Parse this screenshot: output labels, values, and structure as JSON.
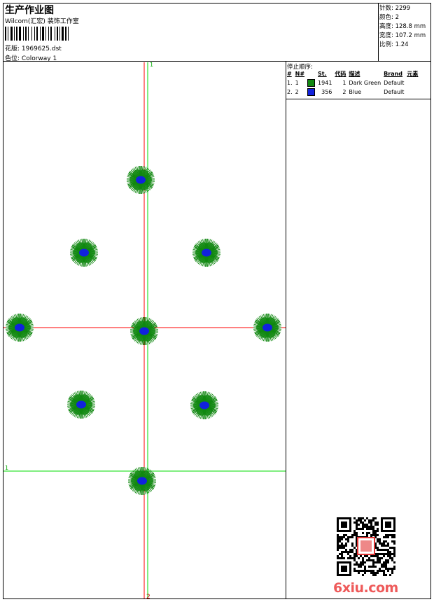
{
  "header": {
    "title": "生产作业图",
    "studio": "Wilcom(汇宏) 装饰工作室",
    "pattern_label": "花版:",
    "pattern_value": "1969625.dst",
    "color_label": "色位:",
    "color_value": "Colorway 1"
  },
  "stats": {
    "stitches_label": "针数:",
    "stitches_value": "2299",
    "colors_label": "颜色:",
    "colors_value": "2",
    "height_label": "高度:",
    "height_value": "128.8 mm",
    "width_label": "宽度:",
    "width_value": "107.2 mm",
    "ratio_label": "比例:",
    "ratio_value": "1.24"
  },
  "stop_sequence": {
    "title": "停止顺序:",
    "headers": {
      "num": "#",
      "needle": "N#",
      "stitches": "St.",
      "code": "代码",
      "desc": "描述",
      "brand": "Brand",
      "element": "元素"
    },
    "rows": [
      {
        "num": "1.",
        "needle": "1",
        "color": "#118811",
        "stitches": "1941",
        "code": "1",
        "desc": "Dark Green",
        "brand": "Default"
      },
      {
        "num": "2.",
        "needle": "2",
        "color": "#1122dd",
        "stitches": "356",
        "code": "2",
        "desc": "Blue",
        "brand": "Default"
      }
    ]
  },
  "design": {
    "axis_markers": {
      "top": "1",
      "left": "1",
      "bottom": "2"
    },
    "petal_color": "#118811",
    "center_color": "#1122dd",
    "vertical_line_color": "#ff0000",
    "guide_line_color": "#00dd00"
  },
  "watermark": {
    "text": "6xiu.com"
  }
}
